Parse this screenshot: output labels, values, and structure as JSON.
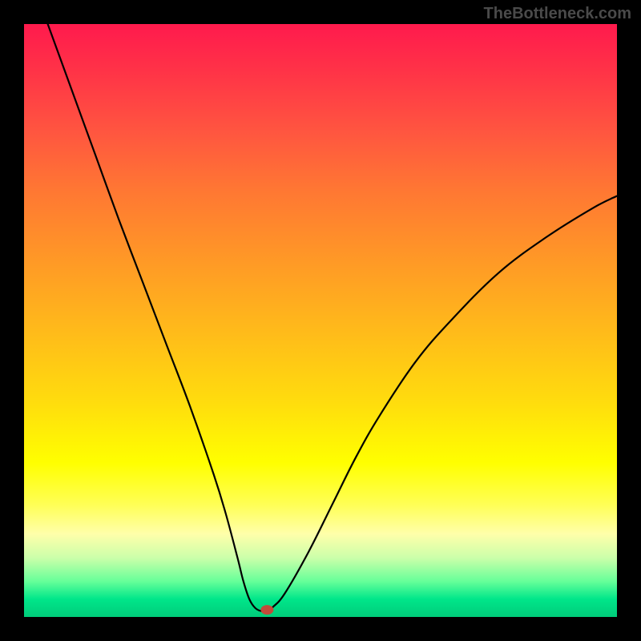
{
  "watermark": "TheBottleneck.com",
  "chart_data": {
    "type": "line",
    "title": "",
    "xlabel": "",
    "ylabel": "",
    "xlim": [
      0,
      100
    ],
    "ylim": [
      0,
      100
    ],
    "gradient_stops": [
      {
        "pos": 0,
        "color": "#ff1a4d"
      },
      {
        "pos": 8,
        "color": "#ff3347"
      },
      {
        "pos": 18,
        "color": "#ff5540"
      },
      {
        "pos": 28,
        "color": "#ff7733"
      },
      {
        "pos": 40,
        "color": "#ff9926"
      },
      {
        "pos": 52,
        "color": "#ffbb1a"
      },
      {
        "pos": 64,
        "color": "#ffdd0d"
      },
      {
        "pos": 74,
        "color": "#ffff00"
      },
      {
        "pos": 81,
        "color": "#ffff55"
      },
      {
        "pos": 86,
        "color": "#ffffaa"
      },
      {
        "pos": 90,
        "color": "#ccffaa"
      },
      {
        "pos": 94,
        "color": "#66ff99"
      },
      {
        "pos": 97,
        "color": "#00e68a"
      },
      {
        "pos": 100,
        "color": "#00cc7a"
      }
    ],
    "series": [
      {
        "name": "bottleneck-curve",
        "x": [
          4,
          8,
          12,
          16,
          20,
          24,
          28,
          32,
          34,
          36,
          37,
          38,
          39,
          40,
          41,
          42,
          44,
          48,
          52,
          56,
          60,
          66,
          72,
          80,
          88,
          96,
          100
        ],
        "y": [
          100,
          89,
          78,
          67,
          56.5,
          46,
          35.5,
          24,
          17.5,
          10,
          6,
          3,
          1.5,
          1,
          1,
          1.7,
          4,
          11,
          19,
          27,
          34,
          43,
          50,
          58,
          64,
          69,
          71
        ]
      }
    ],
    "marker": {
      "x": 41,
      "y": 1.2,
      "color": "#c24b3a",
      "rx": 8,
      "ry": 6
    }
  }
}
